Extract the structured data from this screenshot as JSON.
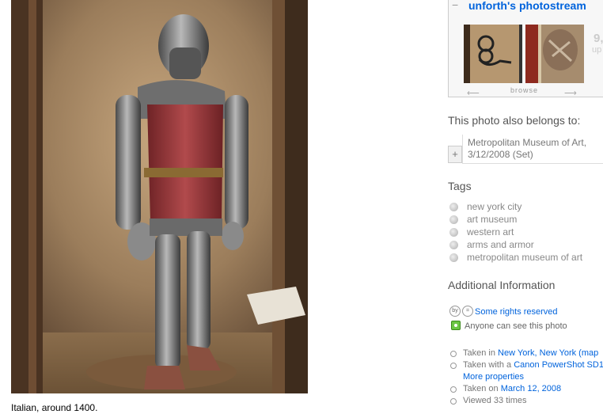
{
  "photo": {
    "caption": "Italian, around 1400."
  },
  "photostream": {
    "toggle": "−",
    "title": "unforth's photostream",
    "count": "9,",
    "count_suffix": "up",
    "browse_label": "browse",
    "prev_arrow": "⟵",
    "next_arrow": "⟶"
  },
  "sets": {
    "heading": "This photo also belongs to:",
    "add": "+",
    "items": [
      {
        "title": "Metropolitan Museum of Art, 3/12/2008 (Set)"
      }
    ]
  },
  "tags": {
    "heading": "Tags",
    "items": [
      "new york city",
      "art museum",
      "western art",
      "arms and armor",
      "metropolitan museum of art"
    ]
  },
  "additional": {
    "heading": "Additional Information",
    "license_icons": [
      "by",
      "="
    ],
    "license_link": "Some rights reserved",
    "privacy": "Anyone can see this photo",
    "taken_in_prefix": "Taken in",
    "taken_in_link": "New York, New York",
    "taken_in_map": "(map",
    "camera_prefix": "Taken with a",
    "camera_link": "Canon PowerShot SD1",
    "more_properties": "More properties",
    "taken_on_prefix": "Taken on",
    "taken_on_link": "March 12, 2008",
    "viewed": "Viewed 33 times"
  },
  "colors": {
    "link": "#0063dc",
    "heading": "#555555",
    "muted": "#777777"
  }
}
